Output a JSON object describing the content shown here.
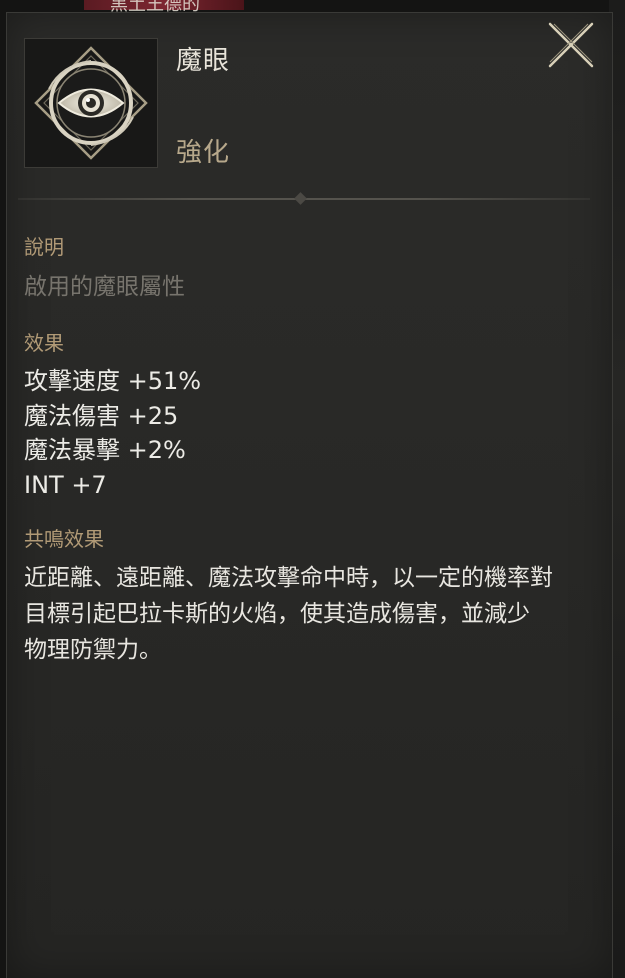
{
  "background": {
    "top_text": "黑土王德的"
  },
  "item": {
    "icon": "eye-icon",
    "name": "魔眼",
    "type": "強化"
  },
  "close_icon": "close-x-icon",
  "sections": {
    "description": {
      "label": "說明",
      "text": "啟用的魔眼屬性"
    },
    "effects": {
      "label": "效果",
      "items": [
        "攻擊速度 +51%",
        "魔法傷害 +25",
        "魔法暴擊 +2%",
        "INT +7"
      ]
    },
    "resonance": {
      "label": "共鳴效果",
      "lines": [
        "近距離、遠距離、魔法攻擊命中時，以一定的機率對",
        "目標引起巴拉卡斯的火焰，使其造成傷害，並減少",
        "物理防禦力。"
      ]
    }
  },
  "colors": {
    "panel_bg": "#2b2b29",
    "label_gold": "#b19a76",
    "type_tan": "#b7a88b",
    "text_light": "#ecebe6",
    "text_dim": "#77746d"
  }
}
